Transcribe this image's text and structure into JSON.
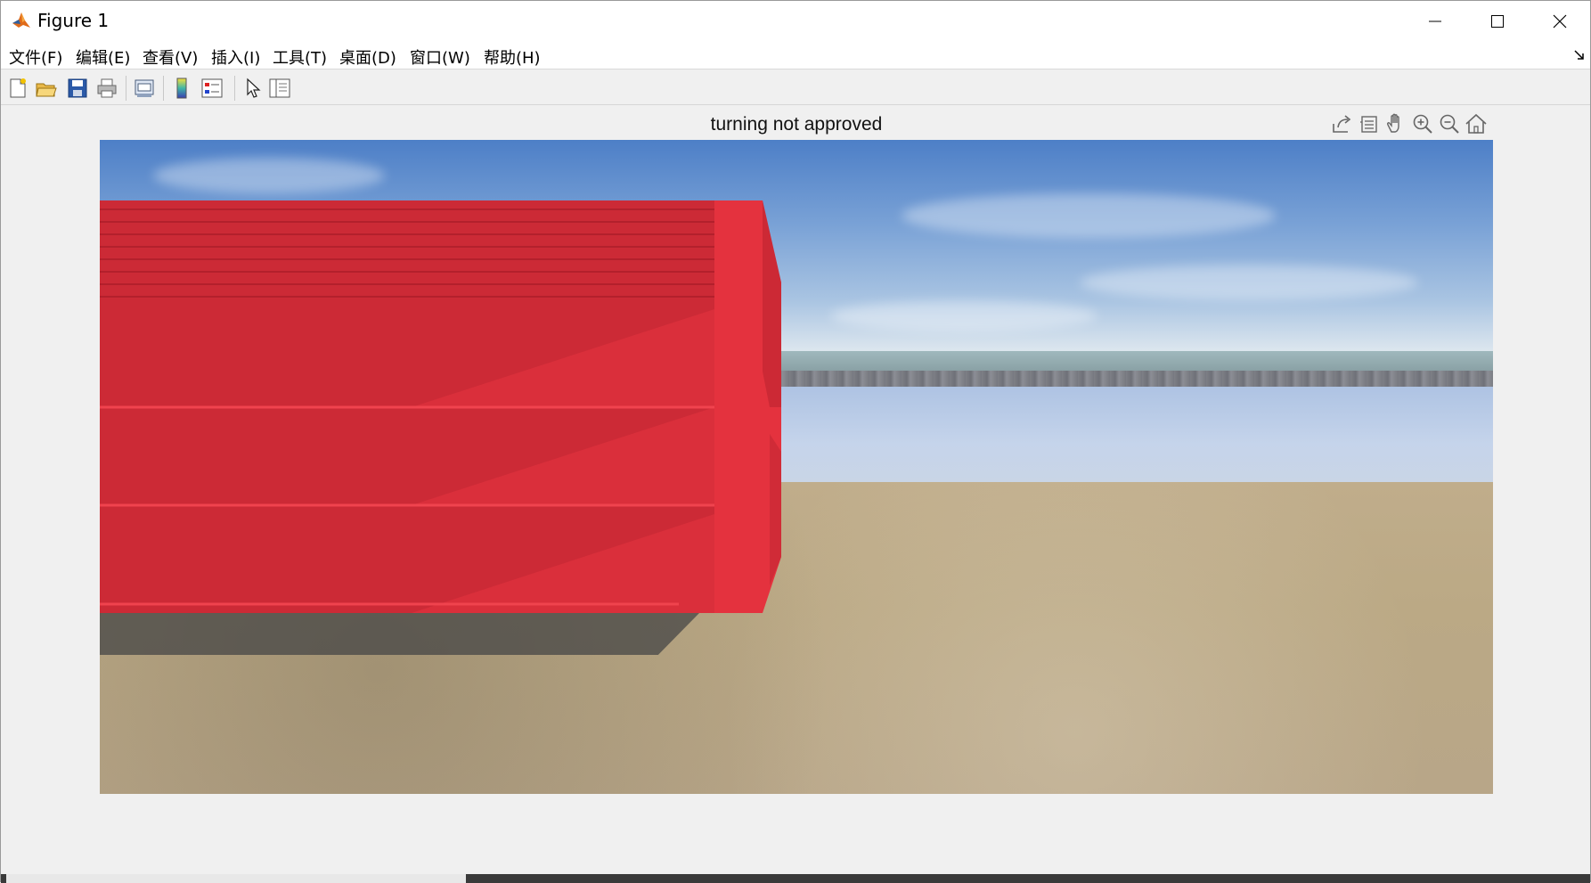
{
  "window": {
    "title": "Figure 1"
  },
  "menu": {
    "file": "文件(F)",
    "edit": "编辑(E)",
    "view": "查看(V)",
    "insert": "插入(I)",
    "tools": "工具(T)",
    "desktop": "桌面(D)",
    "window": "窗口(W)",
    "help": "帮助(H)"
  },
  "toolbar": {
    "buttons": [
      "new-figure-icon",
      "open-file-icon",
      "save-icon",
      "print-icon",
      "print-preview-icon",
      "colorbar-icon",
      "legend-icon",
      "pointer-icon",
      "property-inspector-icon"
    ]
  },
  "axes_toolbar": {
    "buttons": [
      "export-icon",
      "brush-icon",
      "pan-hand-icon",
      "zoom-in-icon",
      "zoom-out-icon",
      "home-icon"
    ]
  },
  "plot": {
    "title": "turning not approved"
  },
  "colors": {
    "container_red": "#dc2b35",
    "sky_blue": "#5a8acb",
    "ground_sand": "#bcaa87"
  }
}
